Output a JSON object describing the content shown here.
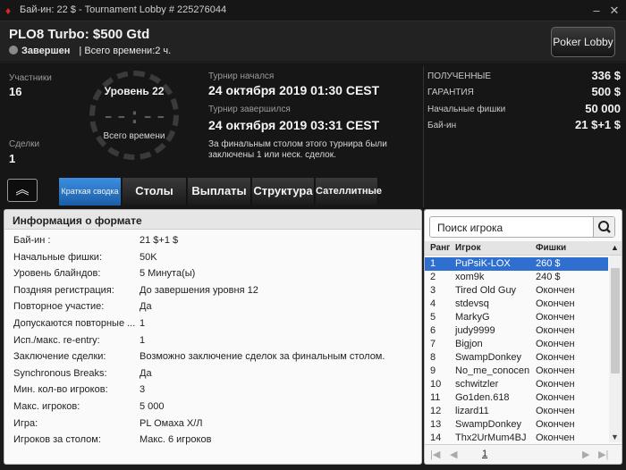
{
  "window": {
    "title": "Бай-ин: 22 $ - Tournament Lobby # 225276044"
  },
  "header": {
    "name": "PLO8 Turbo: $500 Gtd",
    "status": "Завершен",
    "total_time": "| Всего времени:2 ч.",
    "lobby_button": "Poker Lobby"
  },
  "info": {
    "players_label": "Участники",
    "players_value": "16",
    "deals_label": "Сделки",
    "deals_value": "1",
    "level": "Уровень 22",
    "timer": "--:--",
    "total_time": "Всего времени",
    "started_label": "Турнир начался",
    "started_value": "24 октября 2019  01:30 CEST",
    "ended_label": "Турнир завершился",
    "ended_value": "24 октября 2019  03:31 CEST",
    "note_line1": "За финальным столом этого турнира были",
    "note_line2": "заключены 1 или неск. сделок."
  },
  "stats": [
    {
      "label": "ПОЛУЧЕННЫЕ",
      "value": "336 $"
    },
    {
      "label": "ГАРАНТИЯ",
      "value": "500 $"
    },
    {
      "label": "Начальные фишки",
      "value": "50 000"
    },
    {
      "label": "Бай-ин",
      "value": "21 $+1 $"
    }
  ],
  "tabs": [
    "Краткая сводка",
    "Столы",
    "Выплаты",
    "Структура",
    "Сателлитные"
  ],
  "format": {
    "title": "Информация о формате",
    "rows": [
      {
        "k": "Бай-ин :",
        "v": "21 $+1 $"
      },
      {
        "k": "Начальные фишки:",
        "v": "50K"
      },
      {
        "k": "Уровень блайндов:",
        "v": "5 Минута(ы)"
      },
      {
        "k": "Поздняя регистрация:",
        "v": "До завершения уровня 12"
      },
      {
        "k": "Повторное участие:",
        "v": "Да"
      },
      {
        "k": "Допускаются повторные ...",
        "v": "1"
      },
      {
        "k": "Исп./макс. re-entry:",
        "v": "1"
      },
      {
        "k": "Заключение сделки:",
        "v": "Возможно заключение сделок за финальным столом."
      },
      {
        "k": "Synchronous Breaks:",
        "v": "Да"
      },
      {
        "k": "Мин. кол-во игроков:",
        "v": "3"
      },
      {
        "k": "Макс. игроков:",
        "v": "5 000"
      },
      {
        "k": "Игра:",
        "v": "PL Омаха Х/Л"
      },
      {
        "k": "Игроков за столом:",
        "v": "Макс. 6 игроков"
      }
    ]
  },
  "players": {
    "search_placeholder": "Поиск игрока",
    "columns": [
      "Ранг",
      "Игрок",
      "Фишки"
    ],
    "rows": [
      {
        "rank": "1",
        "name": "PuPsiK-LOX",
        "chips": "260 $"
      },
      {
        "rank": "2",
        "name": "xom9k",
        "chips": "240 $"
      },
      {
        "rank": "3",
        "name": "Tired Old Guy",
        "chips": "Окончен"
      },
      {
        "rank": "4",
        "name": "stdevsq",
        "chips": "Окончен"
      },
      {
        "rank": "5",
        "name": "MarkyG",
        "chips": "Окончен"
      },
      {
        "rank": "6",
        "name": "judy9999",
        "chips": "Окончен"
      },
      {
        "rank": "7",
        "name": "Bigjon",
        "chips": "Окончен"
      },
      {
        "rank": "8",
        "name": "SwampDonkey",
        "chips": "Окончен"
      },
      {
        "rank": "9",
        "name": "No_me_conocen",
        "chips": "Окончен"
      },
      {
        "rank": "10",
        "name": "schwitzler",
        "chips": "Окончен"
      },
      {
        "rank": "11",
        "name": "Go1den.618",
        "chips": "Окончен"
      },
      {
        "rank": "12",
        "name": "lizard11",
        "chips": "Окончен"
      },
      {
        "rank": "13",
        "name": "SwampDonkey",
        "chips": "Окончен"
      },
      {
        "rank": "14",
        "name": "Thx2UrMum4BJ",
        "chips": "Окончен"
      }
    ],
    "page": "1"
  }
}
